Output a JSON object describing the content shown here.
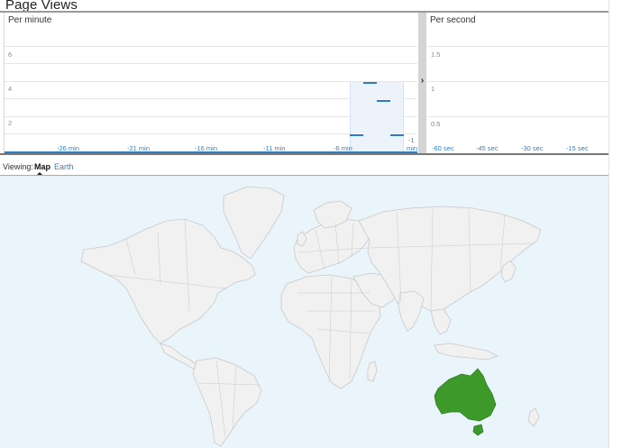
{
  "header": {
    "title": "Page Views"
  },
  "per_minute": {
    "label": "Per minute",
    "y_ticks": [
      "6",
      "4",
      "2"
    ],
    "x_ticks": [
      "-26 min",
      "-21 min",
      "-16 min",
      "-11 min",
      "-6 min",
      "-1",
      "min"
    ]
  },
  "per_second": {
    "label": "Per second",
    "y_ticks": [
      "1.5",
      "1",
      "0.5"
    ],
    "x_ticks": [
      "-60 sec",
      "-45 sec",
      "-30 sec",
      "-15 sec"
    ]
  },
  "divider": {
    "icon": "chevron-right-icon",
    "glyph": "›"
  },
  "viewing": {
    "label": "Viewing:",
    "tabs": [
      "Map",
      "Earth"
    ],
    "active": "Map"
  },
  "map": {
    "highlighted_country": "Australia",
    "colors": {
      "ocean": "#eaf4fb",
      "land": "#f1f1f1",
      "border": "#c9c9c9",
      "highlight": "#3d9a2a"
    }
  },
  "chart_data": [
    {
      "type": "bar",
      "title": "Per minute",
      "x": [
        "-4",
        "-3",
        "-2",
        "-1"
      ],
      "values": [
        1,
        4,
        3,
        1
      ],
      "ylim": [
        0,
        7
      ],
      "y_ticks": [
        2,
        4,
        6
      ],
      "xlabel": "",
      "ylabel": ""
    },
    {
      "type": "bar",
      "title": "Per second",
      "values": [],
      "ylim": [
        0,
        1.7
      ],
      "y_ticks": [
        0.5,
        1,
        1.5
      ]
    }
  ]
}
